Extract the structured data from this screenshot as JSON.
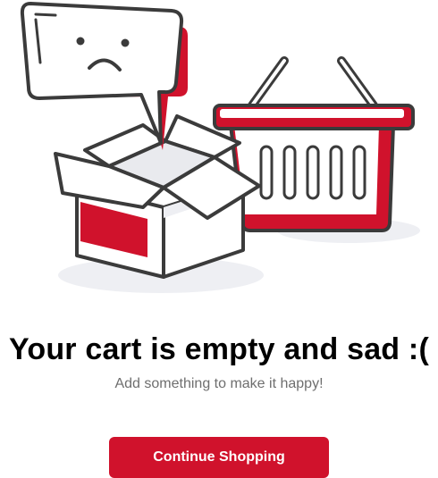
{
  "empty_state": {
    "title": "Your cart is empty and sad :(",
    "subtitle": "Add something to make it happy!",
    "button_label": "Continue Shopping",
    "illustration_icons": [
      "sad-speech-bubble-icon",
      "open-box-icon",
      "shopping-basket-icon"
    ]
  },
  "colors": {
    "accent": "#d0122c",
    "outline": "#3b3b3b",
    "muted_text": "#6e6e6e"
  }
}
